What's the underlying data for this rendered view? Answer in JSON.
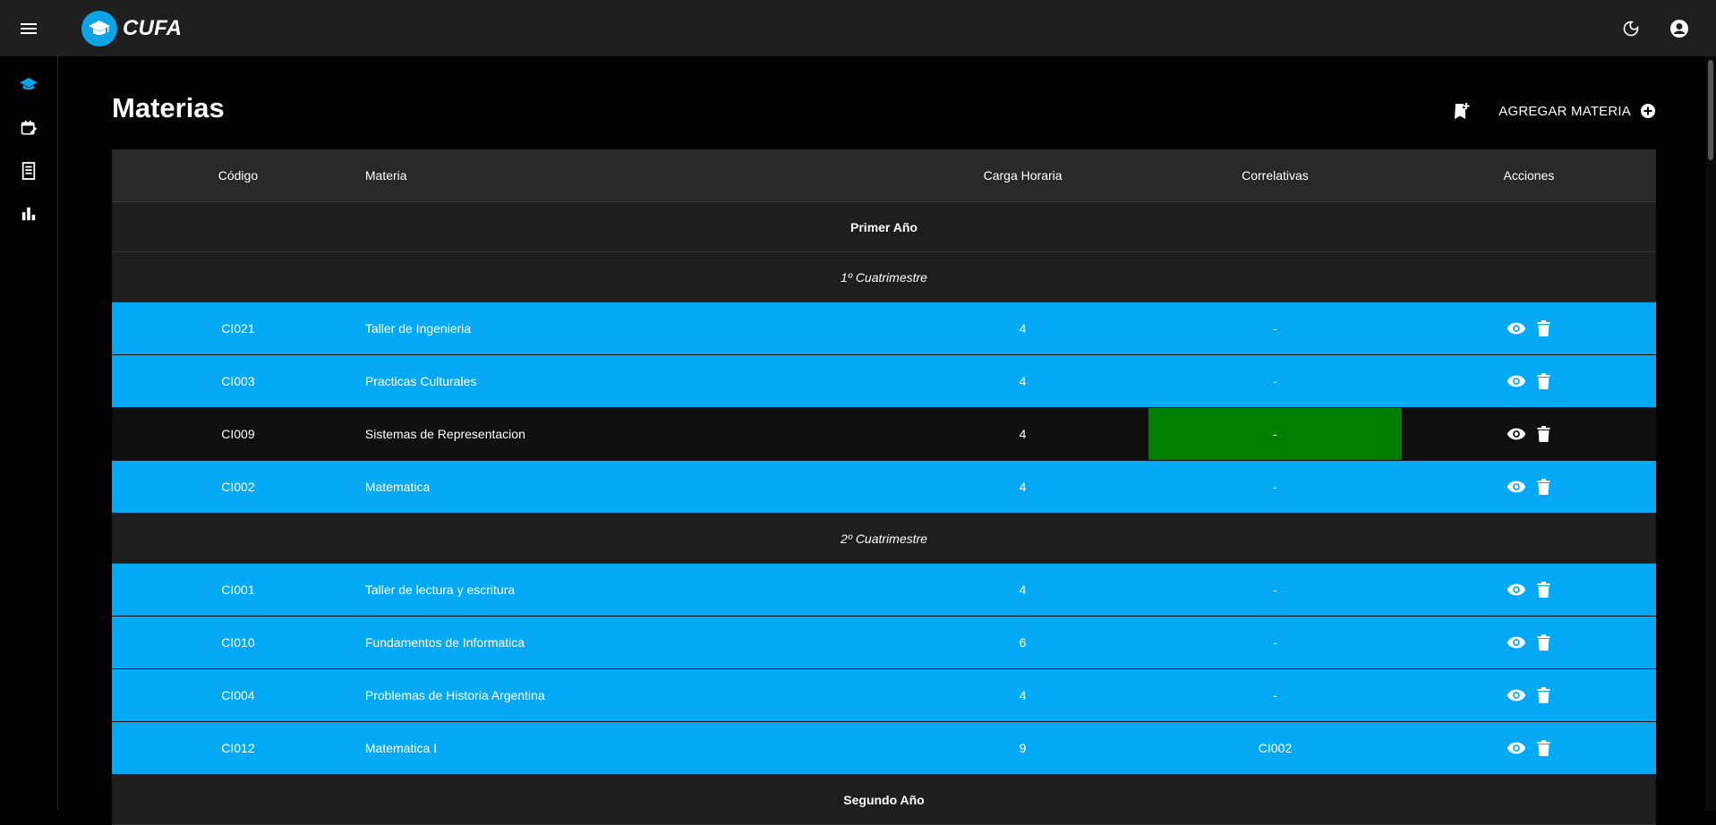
{
  "app": {
    "title": "CUFA"
  },
  "page": {
    "title": "Materias",
    "add_label": "AGREGAR MATERIA"
  },
  "table": {
    "headers": [
      "Código",
      "Materia",
      "Carga Horaria",
      "Correlativas",
      "Acciones"
    ],
    "groups": [
      {
        "label": "Primer Año",
        "type": "year"
      },
      {
        "label": "1º Cuatrimestre",
        "type": "cuatrimestre"
      },
      {
        "label": "2º Cuatrimestre",
        "type": "cuatrimestre"
      },
      {
        "label": "Segundo Año",
        "type": "year"
      }
    ],
    "rows": [
      {
        "codigo": "CI021",
        "materia": "Taller de Ingenieria",
        "carga": "4",
        "correlativas": "-"
      },
      {
        "codigo": "CI003",
        "materia": "Practicas Culturales",
        "carga": "4",
        "correlativas": "-"
      },
      {
        "codigo": "CI009",
        "materia": "Sistemas de Representacion",
        "carga": "4",
        "correlativas": "-"
      },
      {
        "codigo": "CI002",
        "materia": "Matematica",
        "carga": "4",
        "correlativas": "-"
      },
      {
        "codigo": "CI001",
        "materia": "Taller de lectura y escritura",
        "carga": "4",
        "correlativas": "-"
      },
      {
        "codigo": "CI010",
        "materia": "Fundamentos de Informatica",
        "carga": "6",
        "correlativas": "-"
      },
      {
        "codigo": "CI004",
        "materia": "Problemas de Historia Argentina",
        "carga": "4",
        "correlativas": "-"
      },
      {
        "codigo": "CI012",
        "materia": "Matematica I",
        "carga": "9",
        "correlativas": "CI002"
      }
    ]
  },
  "colors": {
    "row_blue": "#03a9f4",
    "highlight_green": "#007e00",
    "topbar": "#1f1f1f",
    "logo_blue": "#0ea2e6"
  },
  "icons": {
    "menu": "menu-icon",
    "logo": "graduation-cap-icon",
    "theme": "moon-icon",
    "account": "account-circle-icon",
    "sidebar": [
      "school-icon",
      "calendar-edit-icon",
      "receipt-icon",
      "bar-chart-icon"
    ],
    "bookmark": "bookmark-add-icon",
    "add": "add-circle-icon",
    "view": "eye-icon",
    "delete": "trash-icon"
  }
}
